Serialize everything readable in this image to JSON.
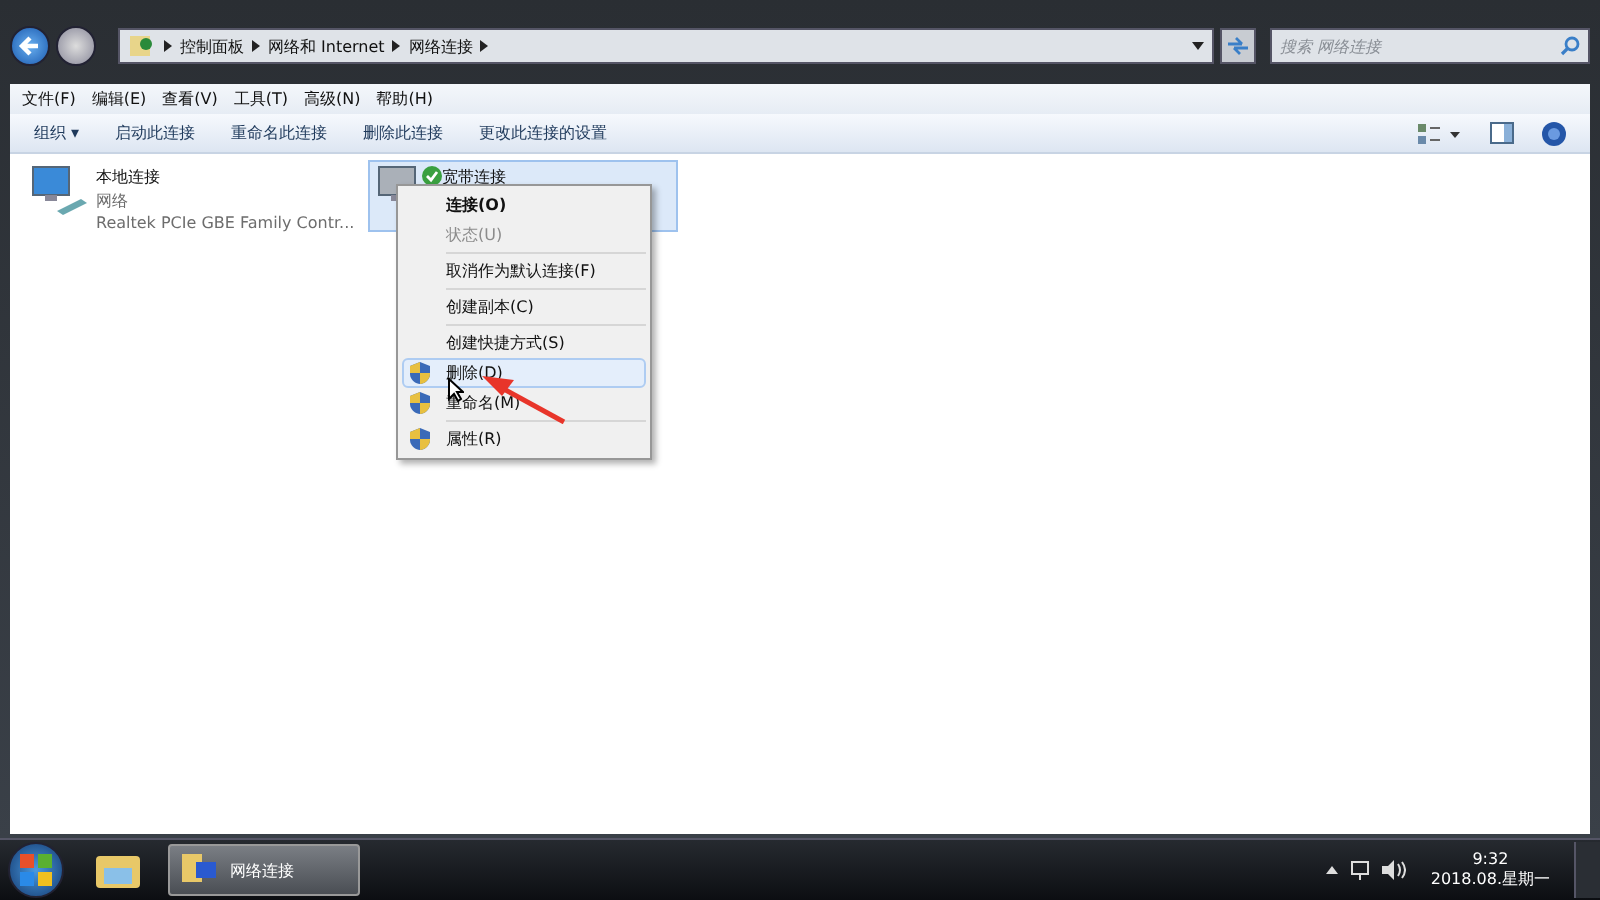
{
  "address_bar": {
    "crumbs": [
      "控制面板",
      "网络和 Internet",
      "网络连接"
    ]
  },
  "search": {
    "placeholder": "搜索 网络连接"
  },
  "menu_bar": [
    "文件(F)",
    "编辑(E)",
    "查看(V)",
    "工具(T)",
    "高级(N)",
    "帮助(H)"
  ],
  "toolbar": [
    "组织 ▾",
    "启动此连接",
    "重命名此连接",
    "删除此连接",
    "更改此连接的设置"
  ],
  "connections": [
    {
      "name": "本地连接",
      "status": "网络",
      "adapter": "Realtek PCIe GBE Family Contr...",
      "selected": false,
      "connected": false
    },
    {
      "name": "宽带连接",
      "selected": true,
      "connected": true
    }
  ],
  "context_menu": [
    [
      {
        "label": "连接(O)",
        "default": true,
        "disabled": false,
        "selected": false,
        "shield": false
      },
      {
        "label": "状态(U)",
        "default": false,
        "disabled": true,
        "selected": false,
        "shield": false
      }
    ],
    [
      {
        "label": "取消作为默认连接(F)",
        "default": false,
        "disabled": false,
        "selected": false,
        "shield": false
      }
    ],
    [
      {
        "label": "创建副本(C)",
        "default": false,
        "disabled": false,
        "selected": false,
        "shield": false
      }
    ],
    [
      {
        "label": "创建快捷方式(S)",
        "default": false,
        "disabled": false,
        "selected": false,
        "shield": false
      },
      {
        "label": "删除(D)",
        "default": false,
        "disabled": false,
        "selected": true,
        "shield": true
      },
      {
        "label": "重命名(M)",
        "default": false,
        "disabled": false,
        "selected": false,
        "shield": true
      }
    ],
    [
      {
        "label": "属性(R)",
        "default": false,
        "disabled": false,
        "selected": false,
        "shield": true
      }
    ]
  ],
  "taskbar": {
    "window_button": "网络连接",
    "time": "9:32",
    "date": "2018.08.星期一"
  }
}
